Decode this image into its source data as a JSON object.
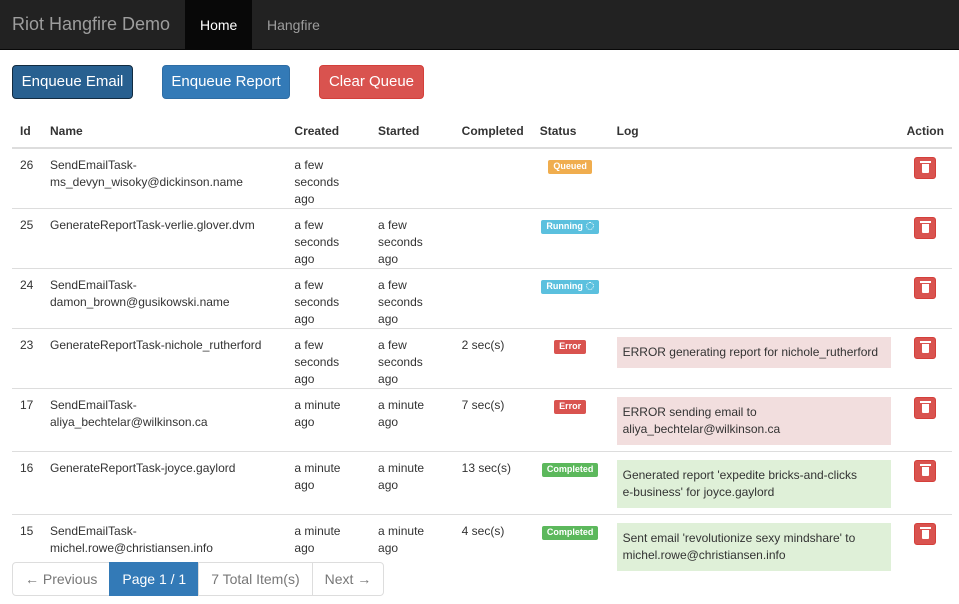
{
  "navbar": {
    "brand": "Riot Hangfire Demo",
    "links": [
      {
        "label": "Home",
        "active": true
      },
      {
        "label": "Hangfire",
        "active": false
      }
    ]
  },
  "actions": {
    "enqueue_email": "Enqueue Email",
    "enqueue_report": "Enqueue Report",
    "clear_queue": "Clear Queue"
  },
  "table": {
    "headers": [
      "Id",
      "Name",
      "Created",
      "Started",
      "Completed",
      "Status",
      "Log",
      "Action"
    ],
    "rows": [
      {
        "id": "26",
        "name": "SendEmailTask-\nms_devyn_wisoky@dickinson.name",
        "created": "a few\nseconds ago",
        "started": "",
        "completed": "",
        "status": "Queued",
        "status_kind": "queued",
        "log": "",
        "log_kind": ""
      },
      {
        "id": "25",
        "name": "GenerateReportTask-verlie.glover.dvm",
        "created": "a few\nseconds ago",
        "started": "a few\nseconds ago",
        "completed": "",
        "status": "Running",
        "status_kind": "running",
        "log": "",
        "log_kind": ""
      },
      {
        "id": "24",
        "name": "SendEmailTask-\ndamon_brown@gusikowski.name",
        "created": "a few\nseconds ago",
        "started": "a few\nseconds ago",
        "completed": "",
        "status": "Running",
        "status_kind": "running",
        "log": "",
        "log_kind": ""
      },
      {
        "id": "23",
        "name": "GenerateReportTask-nichole_rutherford",
        "created": "a few\nseconds ago",
        "started": "a few\nseconds ago",
        "completed": "2 sec(s)",
        "status": "Error",
        "status_kind": "error",
        "log": "ERROR generating report for nichole_rutherford",
        "log_kind": "error"
      },
      {
        "id": "17",
        "name": "SendEmailTask-\naliya_bechtelar@wilkinson.ca",
        "created": "a minute\nago",
        "started": "a minute\nago",
        "completed": "7 sec(s)",
        "status": "Error",
        "status_kind": "error",
        "log": "ERROR sending email to\naliya_bechtelar@wilkinson.ca",
        "log_kind": "error"
      },
      {
        "id": "16",
        "name": "GenerateReportTask-joyce.gaylord",
        "created": "a minute\nago",
        "started": "a minute\nago",
        "completed": "13 sec(s)",
        "status": "Completed",
        "status_kind": "completed",
        "log": "Generated report 'expedite bricks-and-clicks\ne-business' for joyce.gaylord",
        "log_kind": "success"
      },
      {
        "id": "15",
        "name": "SendEmailTask-\nmichel.rowe@christiansen.info",
        "created": "a minute\nago",
        "started": "a minute\nago",
        "completed": "4 sec(s)",
        "status": "Completed",
        "status_kind": "completed",
        "log": "Sent email 'revolutionize sexy mindshare' to\nmichel.rowe@christiansen.info",
        "log_kind": "success"
      }
    ]
  },
  "pagination": {
    "previous": "← Previous",
    "current": "Page 1 / 1",
    "total": "7 Total Item(s)",
    "next": "Next →"
  }
}
